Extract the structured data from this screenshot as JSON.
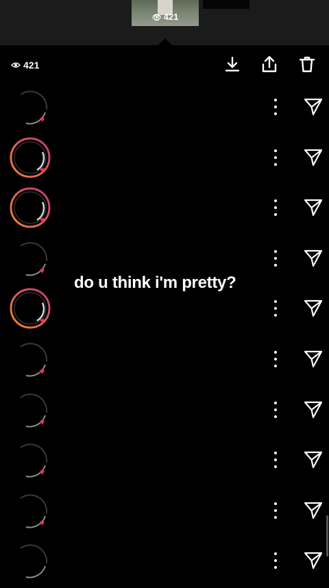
{
  "thumbnail": {
    "views": "421"
  },
  "header": {
    "views": "421",
    "download_icon": "download-icon",
    "share_icon": "share-icon",
    "delete_icon": "trash-icon"
  },
  "caption": "do u think i'm pretty?",
  "viewers": [
    {
      "ring": "gray",
      "heart": true,
      "accent": "#ff2a4a"
    },
    {
      "ring": "gradient",
      "heart": true,
      "accent": "#ff2a4a"
    },
    {
      "ring": "gradient",
      "heart": true,
      "accent": "#ff2a4a"
    },
    {
      "ring": "gray",
      "heart": true,
      "accent": "#ff2a4a"
    },
    {
      "ring": "gradient",
      "heart": true,
      "accent": "#ff2a4a"
    },
    {
      "ring": "gray",
      "heart": true,
      "accent": "#ff2a4a"
    },
    {
      "ring": "gray",
      "heart": true,
      "accent": "#ff2a4a"
    },
    {
      "ring": "gray",
      "heart": true,
      "accent": "#ff2a4a"
    },
    {
      "ring": "gray",
      "heart": true,
      "accent": "#ff2a4a"
    },
    {
      "ring": "gray",
      "heart": false,
      "accent": "#ff2a4a"
    }
  ],
  "colors": {
    "background": "#000000",
    "gradient_start": "#f58529",
    "gradient_end": "#c13584",
    "heart": "#ff2a4a"
  }
}
